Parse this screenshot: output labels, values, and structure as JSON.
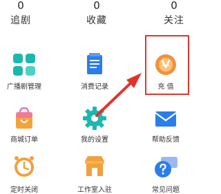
{
  "stats": [
    {
      "value": "0",
      "label": "追剧"
    },
    {
      "value": "0",
      "label": "收藏"
    },
    {
      "value": "0",
      "label": "关注"
    }
  ],
  "grid": [
    {
      "label": "广播剧管理",
      "icon": "grid-icon"
    },
    {
      "label": "消费记录",
      "icon": "document-icon"
    },
    {
      "label": "充 值",
      "icon": "recharge-icon"
    },
    {
      "label": "商城订单",
      "icon": "shopping-bag-icon"
    },
    {
      "label": "我的设置",
      "icon": "gear-icon"
    },
    {
      "label": "帮助反馈",
      "icon": "mail-icon"
    },
    {
      "label": "定时关闭",
      "icon": "clock-icon"
    },
    {
      "label": "工作室入驻",
      "icon": "store-icon"
    },
    {
      "label": "常见问题",
      "icon": "question-chat-icon"
    }
  ],
  "colors": {
    "highlight": "#e0342a",
    "teal": "#1bb8b0",
    "blue": "#2b7de9",
    "orange": "#f2a03d"
  }
}
